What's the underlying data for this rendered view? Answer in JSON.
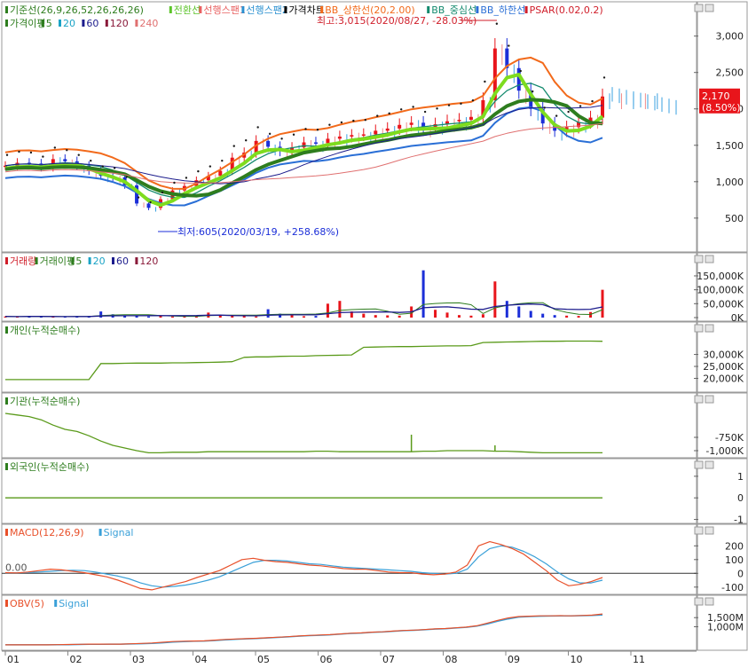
{
  "chart_data": {
    "type": "stock_multi_panel",
    "x_months": [
      "01",
      "02",
      "03",
      "04",
      "05",
      "06",
      "07",
      "08",
      "09",
      "10",
      "11"
    ],
    "colors": {
      "candle_up": "#e8151b",
      "candle_down": "#1c2fd8",
      "base_line": "#2e7d1e",
      "conversion_line": "#7edc1e",
      "span1": "#f08a8a",
      "span2": "#3aa0e0",
      "bb_upper": "#f26a1b",
      "bb_mid": "#138a6e",
      "bb_lower": "#2a6fd6",
      "psar": "#1a1a1a",
      "ma5": "#2e7d1e",
      "ma20": "#1aa3c6",
      "ma60": "#1c1c8c",
      "ma120": "#8a1a3a",
      "ma240": "#e07070",
      "panel_line": "#5a9a1a",
      "macd": "#e8502a",
      "signal": "#3aa0d8"
    },
    "panels": [
      {
        "id": "price",
        "legend": [
          {
            "text": "기준선(26,9,26,52,26,26,26)",
            "color": "#2e7d1e"
          },
          {
            "text": "전환선",
            "color": "#5cc42a"
          },
          {
            "text": "선행스팬1",
            "color": "#e86060"
          },
          {
            "text": "선행스팬2",
            "color": "#2a90d0"
          },
          {
            "text": "가격차트",
            "color": "#000000"
          },
          {
            "text": "BB_상한선(20,2.00)",
            "color": "#f26a1b"
          },
          {
            "text": "BB_중심선",
            "color": "#138a6e"
          },
          {
            "text": "BB_하한선",
            "color": "#2a6fd6"
          },
          {
            "text": "PSAR(0.02,0.2)",
            "color": "#d01e2a"
          }
        ],
        "legend2": [
          {
            "text": "가격이평",
            "color": "#2e7d1e"
          },
          {
            "text": "5",
            "color": "#2e7d1e"
          },
          {
            "text": "20",
            "color": "#1aa3c6"
          },
          {
            "text": "60",
            "color": "#1c1c8c"
          },
          {
            "text": "120",
            "color": "#8a1a3a"
          },
          {
            "text": "240",
            "color": "#e07070"
          }
        ],
        "y_ticks": [
          "3,000",
          "2,500",
          "2,000",
          "1,500",
          "1,000",
          "500"
        ],
        "y_tick_values": [
          3000,
          2500,
          2000,
          1500,
          1000,
          500
        ],
        "y_range": [
          230,
          3130
        ],
        "max_annotation": "최고:3,015(2020/08/27, -28.03%)",
        "min_annotation": "최저:605(2020/03/19, +258.68%)",
        "last_price": "2,170",
        "last_change": "(8.50%)",
        "closes": [
          1220,
          1260,
          1250,
          1200,
          1310,
          1280,
          1220,
          1150,
          1080,
          1060,
          950,
          700,
          640,
          760,
          880,
          940,
          1020,
          1080,
          1150,
          1330,
          1400,
          1560,
          1480,
          1420,
          1470,
          1540,
          1530,
          1590,
          1620,
          1640,
          1650,
          1700,
          1730,
          1780,
          1810,
          1750,
          1790,
          1830,
          1850,
          1890,
          2120,
          2830,
          2560,
          2250,
          2000,
          1800,
          1700,
          1750,
          1820,
          1880,
          2170
        ]
      },
      {
        "id": "volume",
        "legend": [
          {
            "text": "거래량",
            "color": "#d01e2a"
          },
          {
            "text": "거래이평",
            "color": "#2e7d1e"
          },
          {
            "text": "5",
            "color": "#2e7d1e"
          },
          {
            "text": "20",
            "color": "#1aa3c6"
          },
          {
            "text": "60",
            "color": "#1c1c8c"
          },
          {
            "text": "120",
            "color": "#8a1a3a"
          }
        ],
        "y_ticks": [
          "150,000K",
          "100,000K",
          "50,000K",
          "0K"
        ],
        "y_tick_values": [
          150000,
          100000,
          50000,
          0
        ],
        "y_range": [
          0,
          185000
        ],
        "values": [
          4000,
          3000,
          5000,
          4000,
          3000,
          3000,
          4000,
          5000,
          22000,
          12000,
          8000,
          6000,
          4000,
          5000,
          4000,
          3000,
          6000,
          18000,
          9000,
          7000,
          5000,
          4000,
          30000,
          14000,
          8000,
          5000,
          6000,
          50000,
          60000,
          22000,
          14000,
          9000,
          8000,
          7000,
          40000,
          170000,
          28000,
          18000,
          9000,
          7000,
          12000,
          130000,
          60000,
          40000,
          24000,
          14000,
          9000,
          7000,
          6000,
          20000,
          100000
        ]
      },
      {
        "id": "individual",
        "legend": [
          {
            "text": "개인(누적순매수)",
            "color": "#2e7d1e"
          }
        ],
        "y_ticks": [
          "30,000K",
          "25,000K",
          "20,000K"
        ],
        "y_tick_values": [
          30000,
          25000,
          20000
        ],
        "y_range": [
          15000,
          38000
        ],
        "values": [
          19500,
          19500,
          19500,
          19500,
          19500,
          19500,
          19500,
          19500,
          26200,
          26200,
          26300,
          26400,
          26400,
          26400,
          26500,
          26500,
          26600,
          26700,
          26800,
          27000,
          28800,
          29000,
          29000,
          29200,
          29300,
          29300,
          29500,
          29600,
          29700,
          29800,
          33000,
          33100,
          33200,
          33300,
          33300,
          33400,
          33500,
          33600,
          33600,
          33700,
          35000,
          35100,
          35200,
          35300,
          35400,
          35500,
          35500,
          35600,
          35600,
          35600,
          35500
        ]
      },
      {
        "id": "institution",
        "legend": [
          {
            "text": "기관(누적순매수)",
            "color": "#2e7d1e"
          }
        ],
        "y_ticks": [
          "-750K",
          "-1,000K"
        ],
        "y_tick_values": [
          -750,
          -1000
        ],
        "y_range": [
          -1100,
          -200
        ],
        "values": [
          -300,
          -330,
          -360,
          -420,
          -520,
          -600,
          -640,
          -720,
          -820,
          -900,
          -950,
          -1000,
          -1040,
          -1040,
          -1030,
          -1030,
          -1030,
          -1020,
          -1020,
          -1020,
          -1020,
          -1020,
          -1020,
          -1020,
          -1020,
          -1020,
          -1010,
          -1010,
          -1020,
          -1020,
          -1020,
          -1020,
          -1020,
          -1020,
          -1020,
          -1010,
          -1010,
          -1000,
          -1000,
          -1000,
          -1000,
          -1010,
          -1010,
          -1020,
          -1030,
          -1040,
          -1040,
          -1040,
          -1040,
          -1040,
          -1040
        ],
        "spikes": [
          {
            "index": 34,
            "value": -700
          },
          {
            "index": 41,
            "value": -900
          }
        ]
      },
      {
        "id": "foreign",
        "legend": [
          {
            "text": "외국인(누적순매수)",
            "color": "#2e7d1e"
          }
        ],
        "y_ticks": [
          "1",
          "0",
          "-1"
        ],
        "y_tick_values": [
          1,
          0,
          -1
        ],
        "y_range": [
          -1.1,
          1.2
        ],
        "values": [
          0,
          0,
          0,
          0,
          0,
          0,
          0,
          0,
          0,
          0,
          0,
          0,
          0,
          0,
          0,
          0,
          0,
          0,
          0,
          0,
          0,
          0,
          0,
          0,
          0,
          0,
          0,
          0,
          0,
          0,
          0,
          0,
          0,
          0,
          0,
          0,
          0,
          0,
          0,
          0,
          0,
          0,
          0,
          0,
          0,
          0,
          0,
          0,
          0,
          0,
          0
        ]
      },
      {
        "id": "macd",
        "legend": [
          {
            "text": "MACD(12,26,9)",
            "color": "#e8502a"
          },
          {
            "text": "Signal",
            "color": "#3aa0d8"
          }
        ],
        "zero_label": "0.00",
        "y_ticks": [
          "200",
          "100",
          "0",
          "-100"
        ],
        "y_tick_values": [
          200,
          100,
          0,
          -100
        ],
        "y_range": [
          -140,
          260
        ],
        "macd": [
          5,
          3,
          10,
          20,
          30,
          25,
          15,
          5,
          -10,
          -25,
          -50,
          -80,
          -110,
          -120,
          -100,
          -80,
          -60,
          -30,
          -5,
          20,
          60,
          100,
          110,
          95,
          85,
          80,
          70,
          60,
          55,
          45,
          35,
          30,
          30,
          20,
          10,
          5,
          5,
          -5,
          -10,
          -5,
          10,
          60,
          200,
          230,
          210,
          180,
          140,
          80,
          20,
          -50,
          -90,
          -80,
          -60,
          -30
        ],
        "signal": [
          3,
          4,
          6,
          10,
          15,
          20,
          22,
          20,
          10,
          -5,
          -20,
          -40,
          -70,
          -90,
          -100,
          -95,
          -85,
          -70,
          -50,
          -25,
          10,
          45,
          80,
          95,
          95,
          90,
          80,
          70,
          65,
          55,
          45,
          40,
          35,
          30,
          25,
          20,
          15,
          5,
          0,
          -5,
          0,
          30,
          120,
          180,
          200,
          190,
          160,
          120,
          70,
          10,
          -40,
          -70,
          -70,
          -50
        ],
        "points_note_count": 54
      },
      {
        "id": "obv",
        "legend": [
          {
            "text": "OBV(5)",
            "color": "#e8502a"
          },
          {
            "text": "Signal",
            "color": "#3aa0d8"
          }
        ],
        "y_ticks": [
          "1,500M",
          "1,000M"
        ],
        "y_tick_values": [
          1500,
          1000
        ],
        "y_range": [
          -250,
          2000
        ],
        "obv": [
          0,
          0,
          0,
          0,
          0,
          10,
          20,
          30,
          40,
          40,
          40,
          40,
          60,
          80,
          100,
          140,
          180,
          200,
          210,
          220,
          260,
          300,
          320,
          340,
          360,
          390,
          420,
          450,
          490,
          520,
          540,
          560,
          600,
          640,
          660,
          700,
          720,
          760,
          790,
          810,
          840,
          880,
          900,
          940,
          980,
          1050,
          1200,
          1350,
          1480,
          1560,
          1580,
          1600,
          1600,
          1610,
          1600,
          1620,
          1640,
          1700
        ],
        "signal": [
          0,
          0,
          0,
          0,
          0,
          5,
          10,
          20,
          30,
          35,
          40,
          40,
          50,
          65,
          85,
          110,
          150,
          180,
          200,
          210,
          240,
          280,
          310,
          330,
          350,
          380,
          410,
          440,
          480,
          510,
          530,
          550,
          590,
          630,
          650,
          690,
          710,
          750,
          780,
          800,
          830,
          870,
          890,
          930,
          970,
          1030,
          1150,
          1300,
          1430,
          1530,
          1560,
          1580,
          1590,
          1600,
          1600,
          1610,
          1620,
          1650
        ]
      }
    ]
  }
}
